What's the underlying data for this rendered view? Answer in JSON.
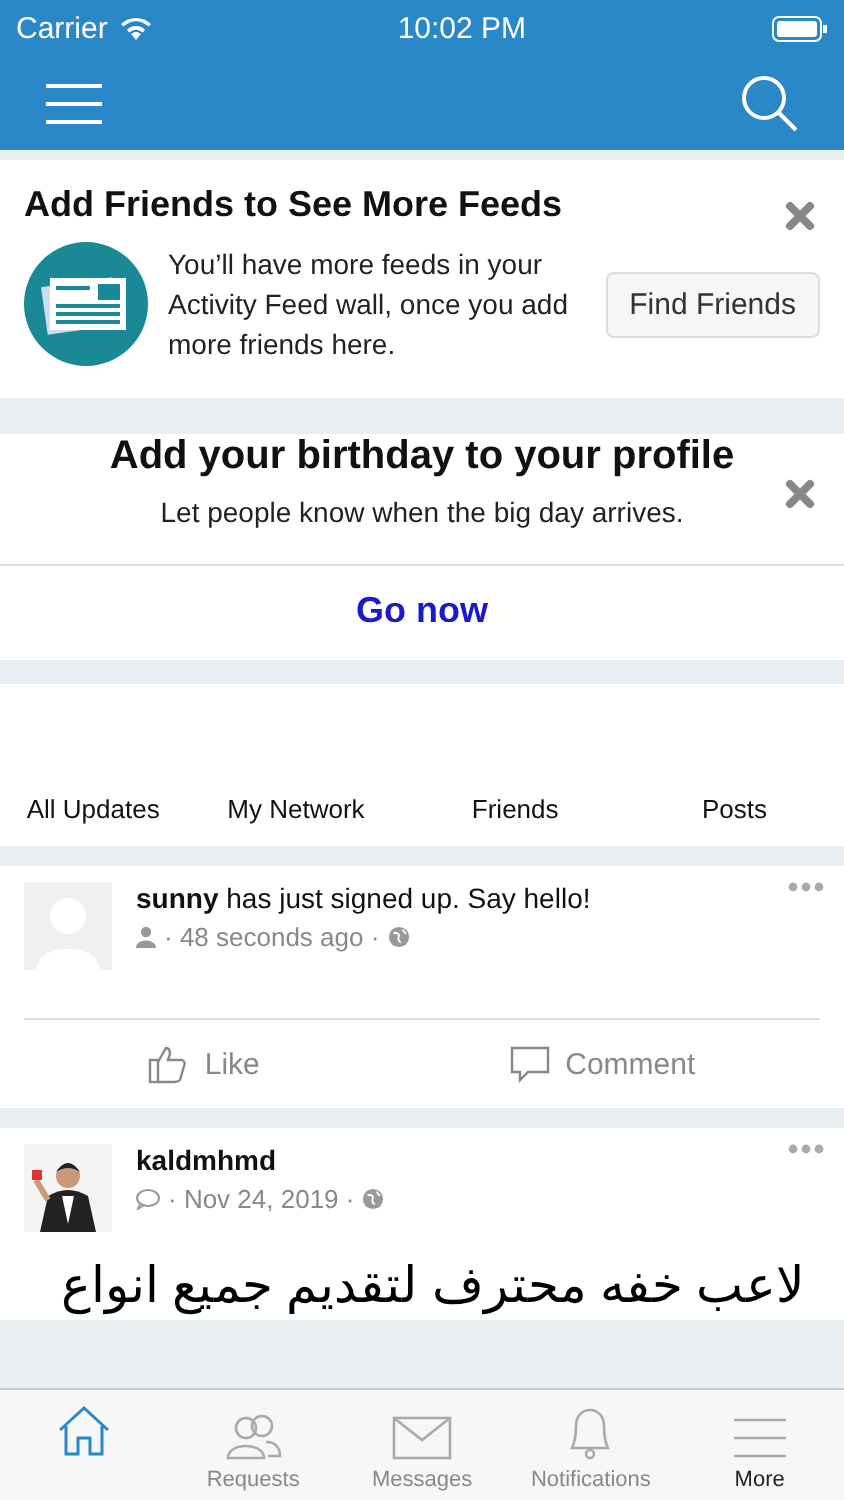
{
  "status_bar": {
    "carrier": "Carrier",
    "time": "10:02 PM"
  },
  "friends_card": {
    "title": "Add Friends to See More Feeds",
    "text": "You’ll have more feeds in your Activity Feed wall, once you add more friends here.",
    "button": "Find Friends"
  },
  "birthday_card": {
    "title": "Add your birthday to your profile",
    "subtitle": "Let people know when the big day arrives.",
    "link": "Go now"
  },
  "feed_tabs": [
    {
      "label": "All Updates",
      "selected": false
    },
    {
      "label": "My Network",
      "selected": false
    },
    {
      "label": "Friends",
      "selected": false
    },
    {
      "label": "Posts",
      "selected": false
    }
  ],
  "posts": [
    {
      "kind": "signup",
      "author": "sunny",
      "text": " has just signed up. Say hello!",
      "meta": "· 48 seconds ago ·",
      "actions": [
        "Like",
        "Comment"
      ]
    },
    {
      "kind": "status",
      "author": "kaldmhmd",
      "meta": "· Nov 24, 2019 ·",
      "body": "لاعب خفه محترف  لتقديم  جميع انواع"
    }
  ],
  "tab_bar": [
    {
      "selected": true
    },
    {
      "label": "Requests",
      "selected": false
    },
    {
      "label": "Messages",
      "selected": false
    },
    {
      "label": "Notifications",
      "selected": false
    },
    {
      "label": "More",
      "selected": false
    }
  ]
}
